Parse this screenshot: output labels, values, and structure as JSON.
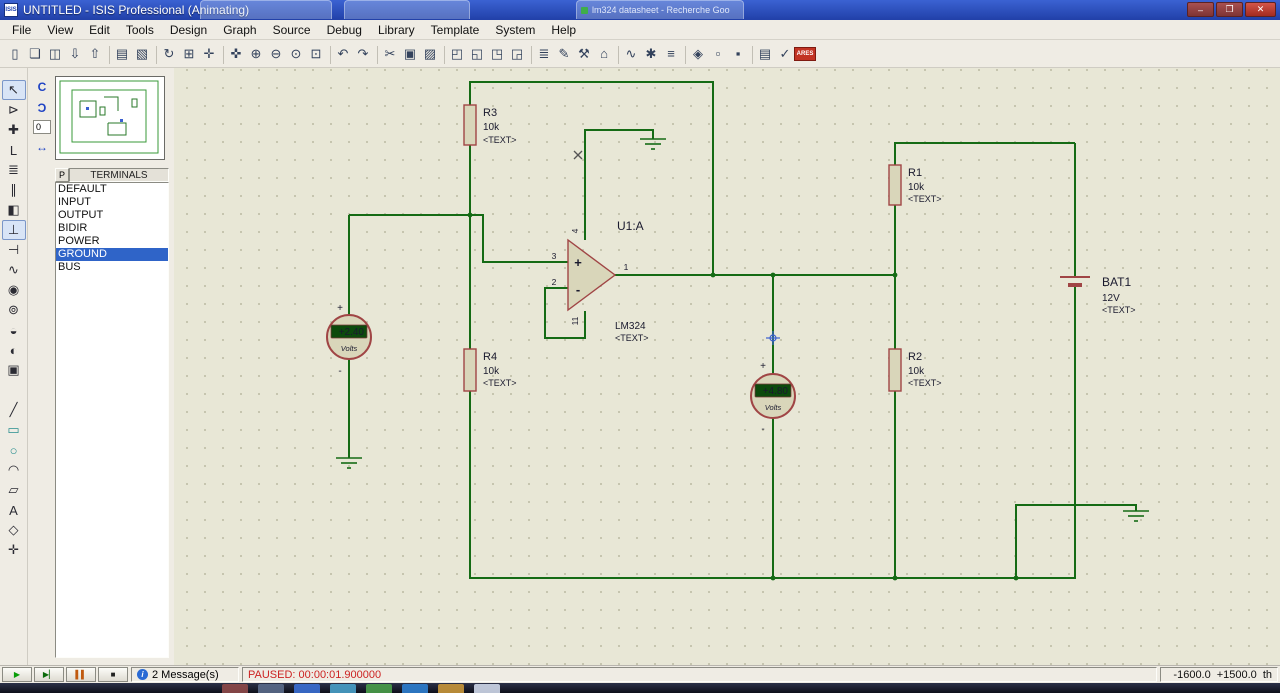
{
  "window": {
    "icon_text": "ISIS",
    "title": "UNTITLED - ISIS Professional (Animating)",
    "ghost_tab_text": "lm324 datasheet - Recherche Goo",
    "minimize": "–",
    "restore": "❐",
    "close": "✕"
  },
  "menu": {
    "items": [
      {
        "name": "menu-file",
        "label": "File"
      },
      {
        "name": "menu-view",
        "label": "View"
      },
      {
        "name": "menu-edit",
        "label": "Edit"
      },
      {
        "name": "menu-tools",
        "label": "Tools"
      },
      {
        "name": "menu-design",
        "label": "Design"
      },
      {
        "name": "menu-graph",
        "label": "Graph"
      },
      {
        "name": "menu-source",
        "label": "Source"
      },
      {
        "name": "menu-debug",
        "label": "Debug"
      },
      {
        "name": "menu-library",
        "label": "Library"
      },
      {
        "name": "menu-template",
        "label": "Template"
      },
      {
        "name": "menu-system",
        "label": "System"
      },
      {
        "name": "menu-help",
        "label": "Help"
      }
    ]
  },
  "toolbar": {
    "buttons": [
      {
        "name": "new-design-button",
        "glyph": "▯"
      },
      {
        "name": "open-design-button",
        "glyph": "❏"
      },
      {
        "name": "save-design-button",
        "glyph": "◫"
      },
      {
        "name": "import-section-button",
        "glyph": "⇩"
      },
      {
        "name": "export-section-button",
        "glyph": "⇧"
      },
      {
        "name": "separator",
        "sep": true,
        "glyph": "",
        "inter": "false"
      },
      {
        "name": "print-design-button",
        "glyph": "▤"
      },
      {
        "name": "mark-output-area-button",
        "glyph": "▧"
      },
      {
        "name": "separator",
        "sep": true,
        "glyph": "",
        "inter": "false"
      },
      {
        "name": "redraw-button",
        "glyph": "↻"
      },
      {
        "name": "toggle-grid-button",
        "glyph": "⊞"
      },
      {
        "name": "false-origin-button",
        "glyph": "✛"
      },
      {
        "name": "separator",
        "sep": true,
        "glyph": "",
        "inter": "false"
      },
      {
        "name": "center-at-cursor-button",
        "glyph": "✜"
      },
      {
        "name": "zoom-in-button",
        "glyph": "⊕"
      },
      {
        "name": "zoom-out-button",
        "glyph": "⊖"
      },
      {
        "name": "zoom-all-button",
        "glyph": "⊙"
      },
      {
        "name": "zoom-area-button",
        "glyph": "⊡"
      },
      {
        "name": "separator",
        "sep": true,
        "glyph": "",
        "inter": "false"
      },
      {
        "name": "undo-button",
        "glyph": "↶"
      },
      {
        "name": "redo-button",
        "glyph": "↷"
      },
      {
        "name": "separator",
        "sep": true,
        "glyph": "",
        "inter": "false"
      },
      {
        "name": "cut-button",
        "glyph": "✂"
      },
      {
        "name": "copy-button",
        "glyph": "▣"
      },
      {
        "name": "paste-button",
        "glyph": "▨"
      },
      {
        "name": "separator",
        "sep": true,
        "glyph": "",
        "inter": "false"
      },
      {
        "name": "block-copy-button",
        "glyph": "◰"
      },
      {
        "name": "block-move-button",
        "glyph": "◱"
      },
      {
        "name": "block-rotate-button",
        "glyph": "◳"
      },
      {
        "name": "block-delete-button",
        "glyph": "◲"
      },
      {
        "name": "separator",
        "sep": true,
        "glyph": "",
        "inter": "false"
      },
      {
        "name": "pick-parts-button",
        "glyph": "≣"
      },
      {
        "name": "make-device-button",
        "glyph": "✎"
      },
      {
        "name": "packaging-tool-button",
        "glyph": "⚒"
      },
      {
        "name": "decompose-button",
        "glyph": "⌂"
      },
      {
        "name": "separator",
        "sep": true,
        "glyph": "",
        "inter": "false"
      },
      {
        "name": "wire-autorouter-button",
        "glyph": "∿"
      },
      {
        "name": "search-and-tag-button",
        "glyph": "✱"
      },
      {
        "name": "property-assignment-button",
        "glyph": "≡"
      },
      {
        "name": "separator",
        "sep": true,
        "glyph": "",
        "inter": "false"
      },
      {
        "name": "design-explorer-button",
        "glyph": "◈"
      },
      {
        "name": "new-sheet-button",
        "glyph": "▫"
      },
      {
        "name": "remove-sheet-button",
        "glyph": "▪"
      },
      {
        "name": "separator",
        "sep": true,
        "glyph": "",
        "inter": "false"
      },
      {
        "name": "bill-of-materials-button",
        "glyph": "▤"
      },
      {
        "name": "electrical-rules-check-button",
        "glyph": "✓"
      },
      {
        "name": "netlist-to-ares-button",
        "glyph": "ARES",
        "ares": true
      }
    ]
  },
  "orient": {
    "rotate_cw": "C",
    "rotate_ccw": "Ɔ",
    "mirror": "↔",
    "angle": "0"
  },
  "side_tools": {
    "tools": [
      {
        "name": "selection-mode-tool",
        "glyph": "↖",
        "selected": true
      },
      {
        "name": "component-mode-tool",
        "glyph": "⊳"
      },
      {
        "name": "junction-dot-tool",
        "glyph": "✚"
      },
      {
        "name": "wire-label-tool",
        "glyph": "L"
      },
      {
        "name": "text-script-tool",
        "glyph": "≣"
      },
      {
        "name": "bus-tool",
        "glyph": "∥"
      },
      {
        "name": "subcircuit-tool",
        "glyph": "◧"
      },
      {
        "name": "terminals-mode-tool",
        "glyph": "⊥",
        "selected": true
      },
      {
        "name": "device-pins-tool",
        "glyph": "⊣"
      },
      {
        "name": "graph-mode-tool",
        "glyph": "∿"
      },
      {
        "name": "tape-recorder-tool",
        "glyph": "◉"
      },
      {
        "name": "generator-mode-tool",
        "glyph": "⊚"
      },
      {
        "name": "voltage-probe-tool",
        "glyph": "◒"
      },
      {
        "name": "current-probe-tool",
        "glyph": "◐"
      },
      {
        "name": "virtual-instruments-tool",
        "glyph": "▣"
      },
      {
        "name": "tool-spacer",
        "glyph": "",
        "gap": true,
        "inter": "false"
      },
      {
        "name": "2d-line-tool",
        "glyph": "╱"
      },
      {
        "name": "2d-box-tool",
        "glyph": "▭",
        "color": "#2a8f8f"
      },
      {
        "name": "2d-circle-tool",
        "glyph": "○",
        "color": "#2a8f8f"
      },
      {
        "name": "2d-arc-tool",
        "glyph": "◠"
      },
      {
        "name": "2d-path-tool",
        "glyph": "▱"
      },
      {
        "name": "2d-text-tool",
        "glyph": "A"
      },
      {
        "name": "2d-symbols-tool",
        "glyph": "◇"
      },
      {
        "name": "2d-markers-tool",
        "glyph": "✛"
      }
    ]
  },
  "selector": {
    "pick_button": "P",
    "header": "TERMINALS",
    "items": [
      {
        "name": "terminal-default",
        "label": "DEFAULT"
      },
      {
        "name": "terminal-input",
        "label": "INPUT"
      },
      {
        "name": "terminal-output",
        "label": "OUTPUT"
      },
      {
        "name": "terminal-bidir",
        "label": "BIDIR"
      },
      {
        "name": "terminal-power",
        "label": "POWER"
      },
      {
        "name": "terminal-ground",
        "label": "GROUND",
        "selected": true
      },
      {
        "name": "terminal-bus",
        "label": "BUS"
      }
    ]
  },
  "schematic": {
    "r3": {
      "ref": "R3",
      "value": "10k",
      "text": "<TEXT>"
    },
    "r4": {
      "ref": "R4",
      "value": "10k",
      "text": "<TEXT>"
    },
    "r1": {
      "ref": "R1",
      "value": "10k",
      "text": "<TEXT>"
    },
    "r2": {
      "ref": "R2",
      "value": "10k",
      "text": "<TEXT>"
    },
    "bat1": {
      "ref": "BAT1",
      "value": "12V",
      "text": "<TEXT>"
    },
    "opamp": {
      "ref": "U1:A",
      "device": "LM324",
      "text": "<TEXT>",
      "pin_noninv": "3",
      "pin_inv": "2",
      "pin_out": "1",
      "pin_vplus": "4",
      "pin_vminus": "11",
      "plus_sign": "+",
      "minus_sign": "-"
    },
    "voltmeter1": {
      "reading": "+2.40",
      "unit": "Volts",
      "plus": "+",
      "minus": "-"
    },
    "voltmeter2": {
      "reading": "+4.80",
      "unit": "Volts",
      "plus": "+",
      "minus": "-"
    },
    "colors": {
      "wire": "#156b15",
      "component": "#a04545",
      "fill": "#d9d6ba"
    }
  },
  "status": {
    "sim_controls": [
      {
        "name": "run-button",
        "glyph": "▶",
        "color": "#089d08"
      },
      {
        "name": "step-button",
        "glyph": "▶▏",
        "color": "#0a6a0a"
      },
      {
        "name": "pause-button",
        "glyph": "▌▌",
        "color": "#c05a10"
      },
      {
        "name": "stop-button",
        "glyph": "■",
        "color": "#222222"
      }
    ],
    "info_icon": "i",
    "messages": "2 Message(s)",
    "sim_status": "PAUSED: 00:00:01.900000",
    "coord_x": "-1600.0",
    "coord_y": "+1500.0",
    "units": "th"
  },
  "taskbar": {
    "icons": [
      {
        "name": "taskbar-icon-1",
        "color": "#8f4a4a"
      },
      {
        "name": "taskbar-icon-2",
        "color": "#5a6a8a"
      },
      {
        "name": "taskbar-icon-3",
        "color": "#3b6fd4"
      },
      {
        "name": "taskbar-icon-4",
        "color": "#49a0c9"
      },
      {
        "name": "taskbar-icon-5",
        "color": "#4a9e4a"
      },
      {
        "name": "taskbar-icon-6",
        "color": "#2f7fd0"
      },
      {
        "name": "taskbar-icon-7",
        "color": "#c9973b"
      },
      {
        "name": "taskbar-active-app",
        "color": "#cfd8ea"
      }
    ]
  }
}
